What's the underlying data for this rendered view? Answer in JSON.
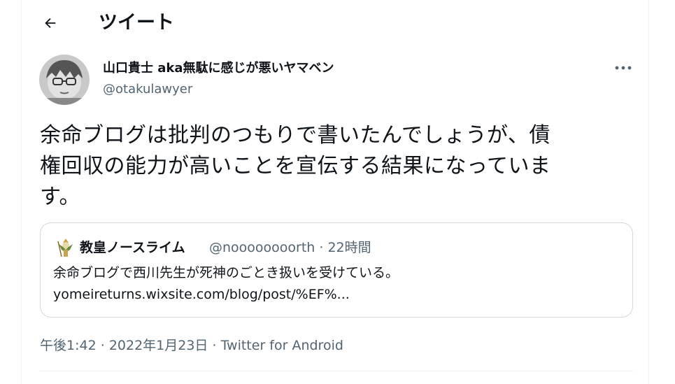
{
  "header": {
    "title": "ツイート"
  },
  "tweet": {
    "display_name": "山口貴士 aka無駄に感じが悪いヤマベン",
    "handle": "@otakulawyer",
    "text_lines": [
      "余命ブログは批判のつもりで書いたんでしょうが、債",
      "権回収の能力が高いことを宣伝する結果になっていま",
      "す。"
    ],
    "time": "午後1:42",
    "date": "2022年1月23日",
    "source": "Twitter for Android",
    "separator": "·"
  },
  "quote": {
    "display_name": "教皇ノースライム",
    "handle_time": "@noooooooorth · 22時間",
    "text_line1": "余命ブログで西川先生が死神のごとき扱いを受けている。",
    "text_line2": "yomeireturns.wixsite.com/blog/post/%EF%..."
  },
  "icons": {
    "back": "arrow-left-icon",
    "more": "more-horizontal-icon"
  },
  "colors": {
    "text": "#0f1419",
    "secondary": "#536471",
    "border": "#cfd9de"
  }
}
